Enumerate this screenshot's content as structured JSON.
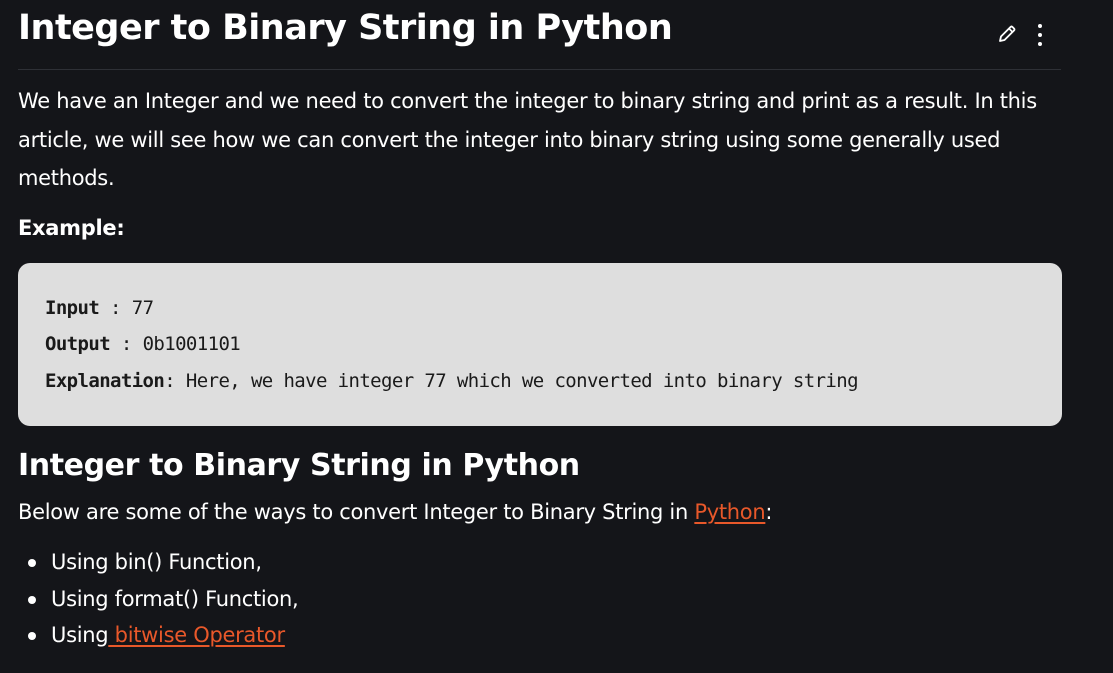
{
  "article": {
    "title": "Integer to Binary String in Python",
    "intro": "We have an Integer and we need to convert the integer to binary string and print as a result. In this article, we will see how we can convert the integer into binary string using some generally used methods.",
    "example_label": "Example:",
    "icons": {
      "edit": "pencil-icon",
      "more": "vertical-ellipsis-icon"
    }
  },
  "code": {
    "lines": [
      {
        "key": "Input",
        "sep": " : ",
        "value": "77"
      },
      {
        "key": "Output",
        "sep": " : ",
        "value": "0b1001101"
      },
      {
        "key": "Explanation",
        "sep": ": ",
        "value": "Here, we have integer 77 which we converted into binary string"
      }
    ]
  },
  "section": {
    "title": "Integer to Binary String in Python",
    "intro_before": "Below are some of the ways to convert Integer to Binary String in ",
    "intro_link": "Python",
    "intro_after": ":",
    "methods": [
      {
        "text": "Using bin() Function,",
        "link": ""
      },
      {
        "text": "Using format() Function,",
        "link": ""
      },
      {
        "text": "Using",
        "link": " bitwise Operator"
      }
    ]
  },
  "colors": {
    "background": "#141519",
    "text": "#ffffff",
    "code_background": "#dedede",
    "link": "#e8582a",
    "divider": "#2e3036"
  }
}
